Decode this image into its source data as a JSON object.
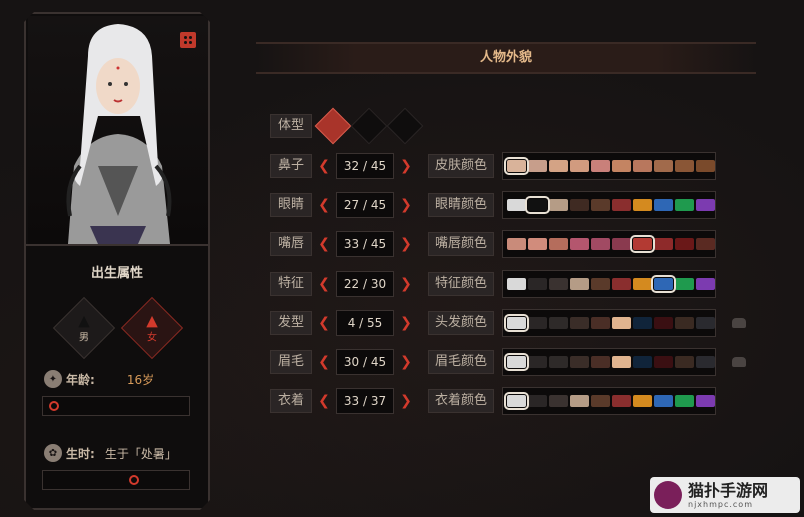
{
  "left": {
    "birth_title": "出生属性",
    "gender": {
      "male": "男",
      "female": "女",
      "selected": "female"
    },
    "age": {
      "label": "年龄:",
      "value": "16岁",
      "slider_level": 0.02
    },
    "birth_time": {
      "label": "生时:",
      "value": "生于「处暑」",
      "slider_level": 0.62
    }
  },
  "right": {
    "section_title": "人物外貌",
    "body_type_label": "体型",
    "body_type_selected": 0,
    "rows": [
      {
        "label": "鼻子",
        "value": "32 / 45",
        "color_label": "皮肤颜色",
        "swatches": [
          "#d9b39a",
          "#c79e8b",
          "#d4a385",
          "#d19b7f",
          "#c9807a",
          "#c48462",
          "#b8775d",
          "#a16a4b",
          "#8a5636",
          "#7a4a2b"
        ],
        "selected": 0,
        "lock": false
      },
      {
        "label": "眼睛",
        "value": "27 / 45",
        "color_label": "眼睛颜色",
        "swatches": [
          "#d9d9d9",
          "#111111",
          "#b59c86",
          "#3f2a22",
          "#5a3a2a",
          "#8a2e2e",
          "#d48a1f",
          "#2e67b5",
          "#1f9a4e",
          "#7c3bb0"
        ],
        "selected": 1,
        "lock": false
      },
      {
        "label": "嘴唇",
        "value": "33 / 45",
        "color_label": "嘴唇颜色",
        "swatches": [
          "#c98b7a",
          "#d18c7c",
          "#b56d5c",
          "#b4566e",
          "#a14a63",
          "#8a3a4f",
          "#b33a33",
          "#8e2a2a",
          "#6a1818",
          "#5a2a22"
        ],
        "selected": 6,
        "lock": false
      },
      {
        "label": "特征",
        "value": "22 / 30",
        "color_label": "特征颜色",
        "swatches": [
          "#d9d9d9",
          "#2a2626",
          "#3a3230",
          "#b59c86",
          "#5a3a2a",
          "#8a2e2e",
          "#d48a1f",
          "#2e67b5",
          "#1f9a4e",
          "#7c3bb0"
        ],
        "selected": 7,
        "lock": false
      },
      {
        "label": "发型",
        "value": "4 / 55",
        "color_label": "头发颜色",
        "swatches": [
          "#d9d9d9",
          "#2a2626",
          "#2e2a29",
          "#3a2d28",
          "#4a2e26",
          "#e0b48f",
          "#10243a",
          "#3a0f12",
          "#3a2a22",
          "#2a2a2f"
        ],
        "selected": 0,
        "lock": true
      },
      {
        "label": "眉毛",
        "value": "30 / 45",
        "color_label": "眉毛颜色",
        "swatches": [
          "#d9d9d9",
          "#2a2626",
          "#2e2a29",
          "#3a2d28",
          "#4a2e26",
          "#e0b48f",
          "#10243a",
          "#3a0f12",
          "#3a2a22",
          "#2a2a2f"
        ],
        "selected": 0,
        "lock": true
      },
      {
        "label": "衣着",
        "value": "33 / 37",
        "color_label": "衣着颜色",
        "swatches": [
          "#d9d9d9",
          "#2a2626",
          "#3a3230",
          "#b59c86",
          "#5a3a2a",
          "#8a2e2e",
          "#d48a1f",
          "#2e67b5",
          "#1f9a4e",
          "#7c3bb0"
        ],
        "selected": 0,
        "lock": false
      }
    ]
  },
  "watermark": {
    "title": "猫扑手游网",
    "url": "njxhmpc.com"
  }
}
